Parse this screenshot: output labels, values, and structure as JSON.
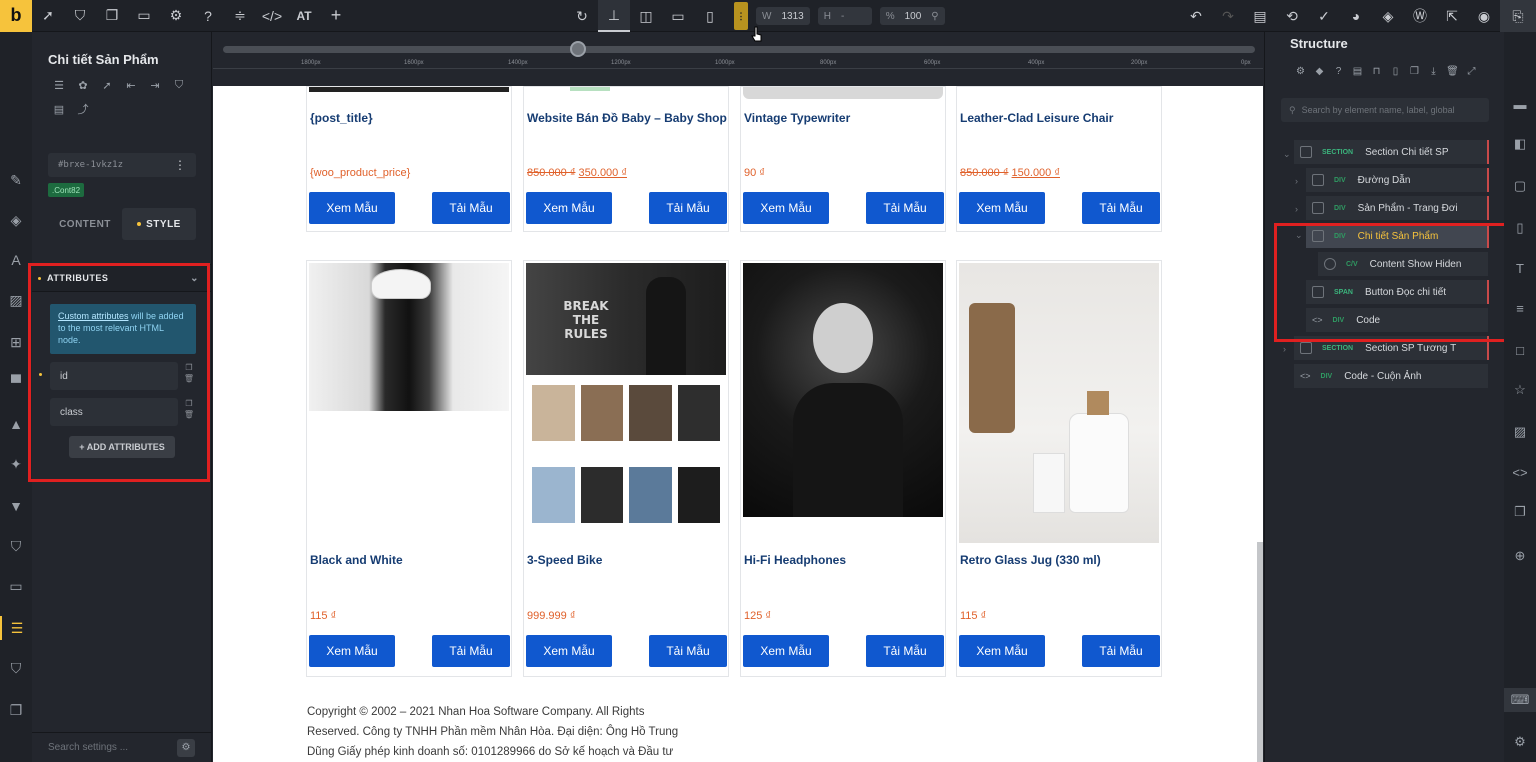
{
  "topbar": {
    "logo": "b",
    "left_icons": [
      "cursor-icon",
      "html5-icon",
      "pages-icon",
      "folder-icon",
      "gear-icon",
      "help-icon",
      "sliders-icon",
      "code-icon"
    ],
    "at_label": "AT",
    "plus_label": "+",
    "width_label": "W",
    "width_value": "1313",
    "height_label": "H",
    "height_value": "-",
    "percent_label": "%",
    "percent_value": "100",
    "handle_label": "⋮"
  },
  "left_panel": {
    "title": "Chi tiết Sản Phẩm",
    "element_id": "#brxe-1vkz1z",
    "class_chip": ".Cont82",
    "tab_content": "CONTENT",
    "tab_style": "STYLE",
    "attributes_header": "ATTRIBUTES",
    "info_link": "Custom attributes",
    "info_text": " will be added to the most relevant HTML node.",
    "attr1": "id",
    "attr2": "class",
    "add_attributes": "+ ADD ATTRIBUTES",
    "search_placeholder": "Search settings ..."
  },
  "ruler": {
    "labels": [
      "1800px",
      "1600px",
      "1400px",
      "1200px",
      "1000px",
      "800px",
      "600px",
      "400px",
      "200px",
      "0px"
    ]
  },
  "products_row1": [
    {
      "title": "{post_title}",
      "price_old": "",
      "price": "{woo_product_price}"
    },
    {
      "title": "Website Bán Đồ Baby – Baby Shop",
      "price_old": "850.000 ₫",
      "price": "350.000 ₫"
    },
    {
      "title": "Vintage Typewriter",
      "price_old": "",
      "price": "90 ₫"
    },
    {
      "title": "Leather-Clad Leisure Chair",
      "price_old": "850.000 ₫",
      "price": "150.000 ₫"
    }
  ],
  "products_row2": [
    {
      "title": "Black and White",
      "price": "115 ₫"
    },
    {
      "title": "3-Speed Bike",
      "price": "999.999 ₫"
    },
    {
      "title": "Hi-Fi Headphones",
      "price": "125 ₫"
    },
    {
      "title": "Retro Glass Jug (330 ml)",
      "price": "115 ₫"
    }
  ],
  "buttons": {
    "view": "Xem Mẫu",
    "download": "Tải Mẫu"
  },
  "mockup": {
    "headline": "BREAK THE RULES"
  },
  "footer": {
    "line1": "Copyright © 2002 – 2021 Nhan Hoa Software Company. All Rights",
    "line2": "Reserved. Công ty TNHH Phần mềm Nhân Hòa. Đại diện: Ông Hồ Trung",
    "line3": "Dũng Giấy phép kinh doanh số: 0101289966 do Sở kế hoạch và Đầu tư"
  },
  "structure": {
    "title": "Structure",
    "search_placeholder": "Search by element name, label, global",
    "nodes": [
      {
        "kind": "SECTION",
        "label": "Section Chi tiết SP"
      },
      {
        "kind": "DIV",
        "label": "Đường Dẫn"
      },
      {
        "kind": "DIV",
        "label": "Sản Phẩm - Trang Đơi"
      },
      {
        "kind": "DIV",
        "label": "Chi tiết Sản Phẩm"
      },
      {
        "kind": "C/V",
        "label": "Content Show Hiden"
      },
      {
        "kind": "SPAN",
        "label": "Button Đọc chi tiết"
      },
      {
        "kind": "DIV",
        "label": "Code"
      },
      {
        "kind": "SECTION",
        "label": "Section SP Tương T"
      },
      {
        "kind": "DIV",
        "label": "Code - Cuộn Ảnh"
      }
    ]
  },
  "colors": {
    "accent": "#f6c33c",
    "button": "#1058cf",
    "price": "#e0612b",
    "title": "#163c72",
    "highlight": "#e02020"
  }
}
